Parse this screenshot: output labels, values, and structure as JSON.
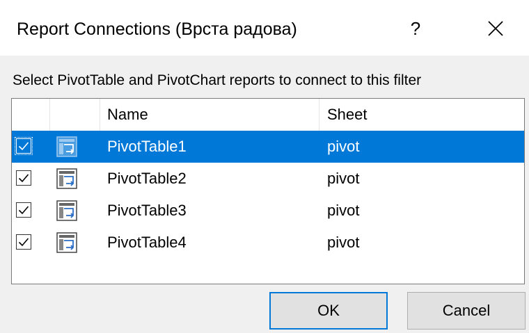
{
  "dialog": {
    "title": "Report Connections (Врста радова)",
    "help_label": "?",
    "instruction": "Select PivotTable and PivotChart reports to connect to this filter"
  },
  "columns": {
    "name": "Name",
    "sheet": "Sheet"
  },
  "rows": [
    {
      "name": "PivotTable1",
      "sheet": "pivot",
      "checked": true,
      "selected": true
    },
    {
      "name": "PivotTable2",
      "sheet": "pivot",
      "checked": true,
      "selected": false
    },
    {
      "name": "PivotTable3",
      "sheet": "pivot",
      "checked": true,
      "selected": false
    },
    {
      "name": "PivotTable4",
      "sheet": "pivot",
      "checked": true,
      "selected": false
    }
  ],
  "buttons": {
    "ok": "OK",
    "cancel": "Cancel"
  },
  "colors": {
    "selection": "#0078d7",
    "default_button_border": "#0078d7",
    "button_face": "#e1e1e1",
    "dialog_bg": "#f0f0f0"
  },
  "icons": {
    "row_icon": "pivot-table-icon",
    "close": "close-icon",
    "check": "checkmark-icon"
  }
}
